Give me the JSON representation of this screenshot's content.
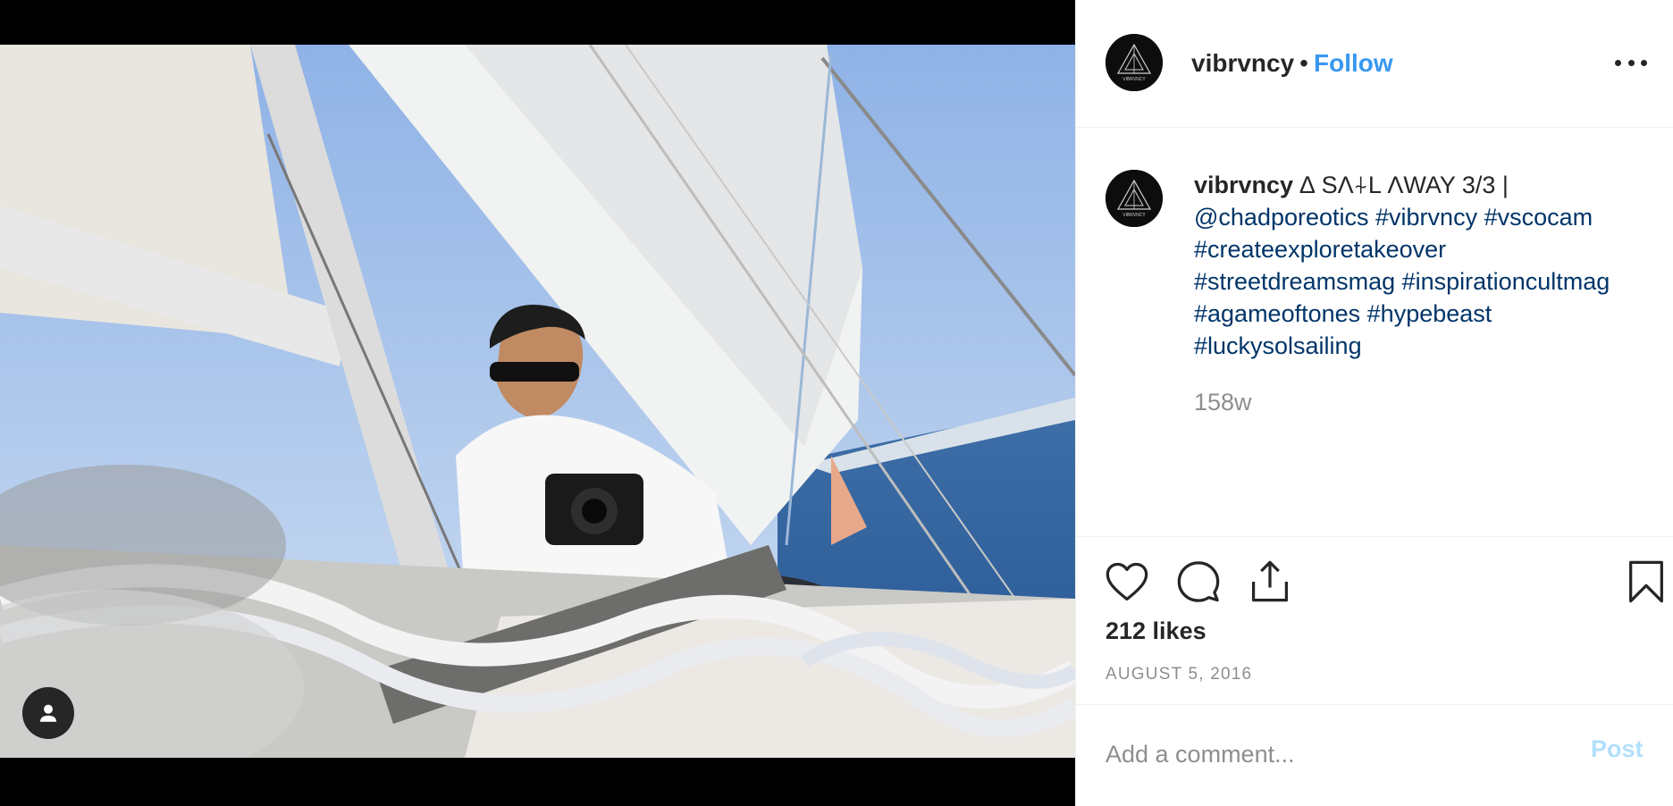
{
  "post": {
    "username": "vibrvncy",
    "separator": "•",
    "follow_label": "Follow",
    "avatar_text": "VIBRVNCY",
    "more_icon": "more-horizontal-icon"
  },
  "caption": {
    "username": "vibrvncy",
    "text": " ∆ SΛ⍭L ΛWAY 3/3 | ",
    "mention": "@chadporeotics",
    "hashtags": [
      "#vibrvncy",
      "#vscocam",
      "#createexploretakeover",
      "#streetdreamsmag",
      "#inspirationcultmag",
      "#agameoftones",
      "#hypebeast",
      "#luckysolsailing"
    ],
    "time_ago": "158w"
  },
  "actions": {
    "like_icon": "heart-icon",
    "comment_icon": "comment-bubble-icon",
    "share_icon": "share-icon",
    "save_icon": "bookmark-icon"
  },
  "likes": "212 likes",
  "date": "AUGUST 5, 2016",
  "comment": {
    "placeholder": "Add a comment...",
    "post_label": "Post"
  },
  "colors": {
    "link_blue": "#3897f0",
    "hashtag_navy": "#003569",
    "muted_gray": "#8e8e8e",
    "post_disabled": "#b2dffc"
  }
}
